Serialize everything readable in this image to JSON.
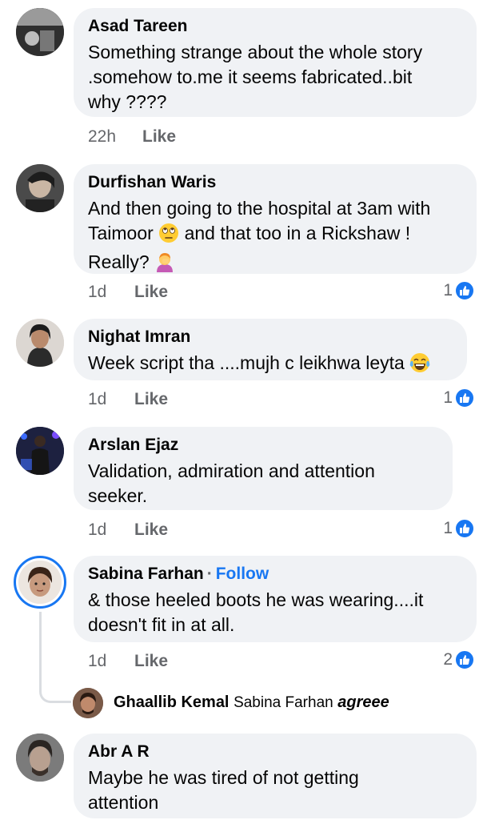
{
  "comments": [
    {
      "name": "Asad Tareen",
      "text": "Something strange about the whole story .somehow to.me it seems fabricated..bit why ????",
      "time": "22h",
      "like_label": "Like",
      "avatar_icon": "avatar-grayscale-photo"
    },
    {
      "name": "Durfishan Waris",
      "text_part1": "And then going to the hospital at 3am with Taimoor",
      "emoji1": "face-with-rolling-eyes",
      "text_part2": "and that too in a Rickshaw ! Really?",
      "emoji2": "person-facepalming",
      "time": "1d",
      "like_label": "Like",
      "reaction_count": "1"
    },
    {
      "name": "Nighat Imran",
      "text": "Week script tha ....mujh c leikhwa leyta",
      "emoji": "face-with-tears-of-joy",
      "time": "1d",
      "like_label": "Like",
      "reaction_count": "1"
    },
    {
      "name": "Arslan Ejaz",
      "text": "Validation, admiration and attention seeker.",
      "time": "1d",
      "like_label": "Like",
      "reaction_count": "1"
    },
    {
      "name": "Sabina Farhan",
      "follow_separator": "·",
      "follow_label": "Follow",
      "text": "& those heeled  boots he was wearing....it doesn't fit in at all.",
      "time": "1d",
      "like_label": "Like",
      "reaction_count": "2"
    },
    {
      "name": "Abr A R",
      "text": "Maybe he was tired of not getting attention"
    }
  ],
  "reply": {
    "name": "Ghaallib Kemal",
    "mention": "Sabina Farhan",
    "text": "agreee"
  },
  "colors": {
    "bubble": "#f0f2f5",
    "accent": "#1877f2",
    "meta": "#65676b"
  }
}
